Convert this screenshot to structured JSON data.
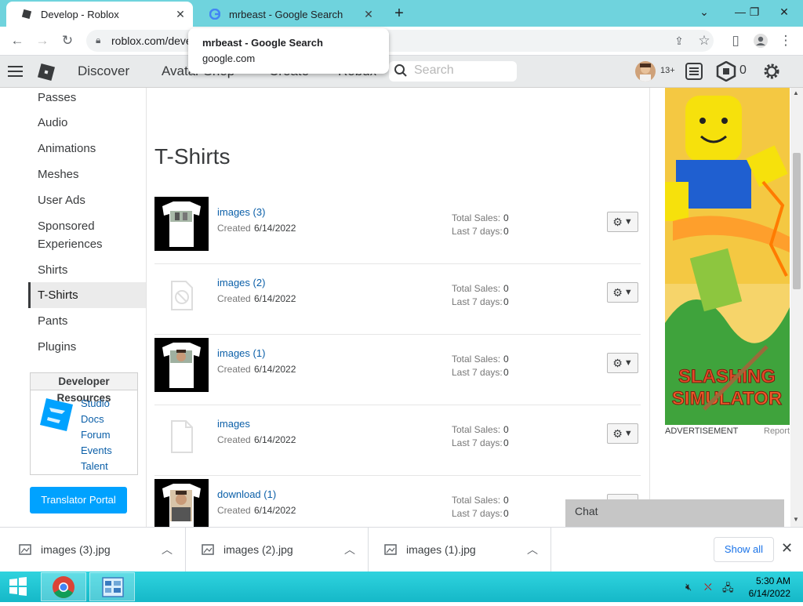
{
  "browser": {
    "tabs": [
      {
        "title": "Develop - Roblox",
        "active": true
      },
      {
        "title": "mrbeast - Google Search",
        "active": false
      }
    ],
    "url": "roblox.com/deve",
    "hover_card": {
      "title": "mrbeast - Google Search",
      "url": "google.com"
    }
  },
  "header": {
    "nav": [
      "Discover",
      "Avatar Shop",
      "Create",
      "Robux"
    ],
    "search_placeholder": "Search",
    "age_badge": "13+",
    "robux_count": "0"
  },
  "sidebar": {
    "items": [
      "Passes",
      "Audio",
      "Animations",
      "Meshes",
      "User Ads",
      "Sponsored Experiences",
      "Shirts",
      "T-Shirts",
      "Pants",
      "Plugins"
    ],
    "active": "T-Shirts",
    "dev_resources": {
      "title": "Developer Resources",
      "links": [
        "Studio",
        "Docs",
        "Forum",
        "Events",
        "Talent"
      ]
    },
    "translator_button": "Translator Portal"
  },
  "main": {
    "title": "T-Shirts",
    "created_label": "Created",
    "total_sales_label": "Total Sales:",
    "last7_label": "Last 7 days:",
    "items": [
      {
        "name": "images (3)",
        "created": "6/14/2022",
        "total_sales": "0",
        "last7": "0",
        "thumb": "shirt-photo"
      },
      {
        "name": "images (2)",
        "created": "6/14/2022",
        "total_sales": "0",
        "last7": "0",
        "thumb": "unavailable"
      },
      {
        "name": "images (1)",
        "created": "6/14/2022",
        "total_sales": "0",
        "last7": "0",
        "thumb": "shirt-face"
      },
      {
        "name": "images",
        "created": "6/14/2022",
        "total_sales": "0",
        "last7": "0",
        "thumb": "pending"
      },
      {
        "name": "download (1)",
        "created": "6/14/2022",
        "total_sales": "0",
        "last7": "0",
        "thumb": "shirt-person"
      }
    ]
  },
  "ad": {
    "label": "ADVERTISEMENT",
    "report": "Report"
  },
  "chat": {
    "label": "Chat"
  },
  "downloads": {
    "files": [
      "images (3).jpg",
      "images (2).jpg",
      "images (1).jpg"
    ],
    "show_all": "Show all"
  },
  "taskbar": {
    "time": "5:30 AM",
    "date": "6/14/2022"
  },
  "colors": {
    "accent": "#00a2ff",
    "tabstrip": "#6fd3dd",
    "link": "#0b5fa8"
  }
}
